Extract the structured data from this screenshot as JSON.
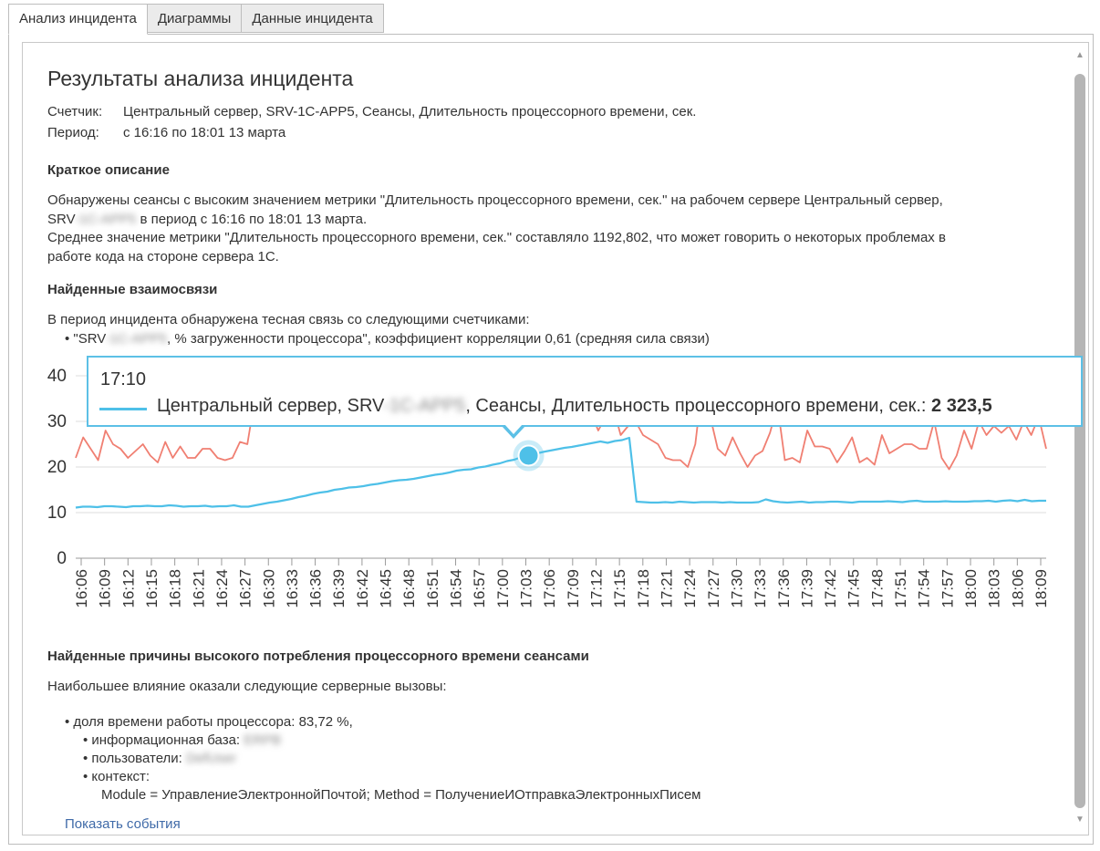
{
  "tabs": [
    {
      "label": "Анализ инцидента",
      "active": true
    },
    {
      "label": "Диаграммы",
      "active": false
    },
    {
      "label": "Данные инцидента",
      "active": false
    }
  ],
  "report": {
    "title": "Результаты анализа инцидента",
    "counter_label": "Счетчик:",
    "counter_value": "Центральный сервер, SRV-1C-APP5, Сеансы, Длительность процессорного времени, сек.",
    "period_label": "Период:",
    "period_value": "с 16:16 по 18:01 13 марта"
  },
  "summary": {
    "heading": "Краткое описание",
    "line1": "Обнаружены сеансы с высоким значением метрики \"Длительность процессорного времени, сек.\" на рабочем сервере Центральный сервер,",
    "line2_prefix": "SRV",
    "line2_blur": "-1C-APP5",
    "line2_suffix": " в период с 16:16 по 18:01 13 марта.",
    "line3": "Среднее значение метрики \"Длительность процессорного времени, сек.\" составляло 1192,802, что может говорить о некоторых проблемах в",
    "line4": "работе кода на стороне сервера 1С."
  },
  "relations": {
    "heading": "Найденные взаимосвязи",
    "intro": "В период инцидента обнаружена тесная связь со следующими счетчиками:",
    "item_prefix": "• \"SRV",
    "item_blur": "-1C-APP5",
    "item_suffix": ", % загруженности процессора\", коэффициент корреляции 0,61 (средняя сила связи)"
  },
  "tooltip": {
    "time": "17:10",
    "series_prefix": "Центральный сервер, SRV",
    "series_blur": "-1C-APP5",
    "series_suffix": ", Сеансы, Длительность процессорного времени, сек.: ",
    "value": "2 323,5"
  },
  "causes": {
    "heading": "Найденные причины высокого потребления процессорного времени сеансами",
    "intro": "Наибольшее влияние оказали следующие серверные вызовы:",
    "cpu_share": "• доля времени работы процессора: 83,72 %,",
    "infobase_label": "• информационная база:",
    "infobase_blur": "ERPB",
    "users_label": "• пользователи:",
    "users_blur": "DefUser",
    "context_label": "• контекст:",
    "context_value": "Module = УправлениеЭлектроннойПочтой; Method = ПолучениеИОтправкаЭлектронныхПисем"
  },
  "show_events_link": "Показать события",
  "colors": {
    "cpu_series": "#f07f72",
    "session_series": "#4ec0e8",
    "accent": "#5cc0e6",
    "link": "#3f6aa8"
  },
  "chart_data": {
    "type": "line",
    "ylim": [
      0,
      40
    ],
    "yticks": [
      "0",
      "10",
      "20",
      "30",
      "40"
    ],
    "x_labels": [
      "16:06",
      "16:09",
      "16:12",
      "16:15",
      "16:18",
      "16:21",
      "16:24",
      "16:27",
      "16:30",
      "16:33",
      "16:36",
      "16:39",
      "16:42",
      "16:45",
      "16:48",
      "16:51",
      "16:54",
      "16:57",
      "17:00",
      "17:03",
      "17:06",
      "17:09",
      "17:12",
      "17:15",
      "17:18",
      "17:21",
      "17:24",
      "17:27",
      "17:30",
      "17:33",
      "17:36",
      "17:39",
      "17:42",
      "17:45",
      "17:48",
      "17:51",
      "17:54",
      "17:57",
      "18:00",
      "18:03",
      "18:06",
      "18:09"
    ],
    "highlight_index": 63,
    "series": [
      {
        "key": "cpu",
        "color": "#f07f72",
        "values": [
          22,
          26.5,
          24,
          21.5,
          28,
          25,
          24,
          22,
          23.5,
          25,
          22.5,
          21,
          25.5,
          22,
          24.5,
          22,
          22,
          24,
          24,
          22,
          21.5,
          22,
          25.5,
          25,
          35,
          32,
          33,
          34,
          35,
          32,
          34,
          33,
          35,
          34,
          31,
          35,
          33,
          36,
          34,
          32,
          33,
          35,
          32,
          35,
          37,
          33,
          34,
          31,
          35,
          33,
          36,
          33,
          32,
          34,
          36,
          33,
          35,
          33,
          34,
          36,
          34,
          32,
          35,
          34,
          37,
          33,
          34,
          36,
          35,
          32,
          28,
          31,
          33,
          27,
          29,
          30,
          27,
          26,
          25,
          22,
          21.5,
          21.5,
          20,
          25,
          39,
          31,
          24,
          22.5,
          26.5,
          23,
          20,
          22.5,
          23.5,
          27.5,
          33.5,
          21.5,
          22,
          21,
          28,
          24.5,
          24.5,
          24,
          21,
          23.5,
          26.5,
          21,
          22,
          20.5,
          27,
          23,
          24,
          25,
          25,
          24,
          24,
          30,
          22,
          19.5,
          22.5,
          28,
          24,
          30,
          27,
          29,
          27.5,
          29,
          26,
          30,
          27,
          31,
          24
        ]
      },
      {
        "key": "sessions",
        "color": "#4ec0e8",
        "values": [
          11.1,
          11.3,
          11.3,
          11.2,
          11.4,
          11.4,
          11.3,
          11.2,
          11.4,
          11.4,
          11.5,
          11.4,
          11.4,
          11.6,
          11.5,
          11.3,
          11.4,
          11.4,
          11.5,
          11.3,
          11.4,
          11.4,
          11.6,
          11.3,
          11.3,
          11.6,
          11.9,
          12.2,
          12.4,
          12.7,
          13.0,
          13.4,
          13.7,
          14.1,
          14.4,
          14.6,
          15.0,
          15.2,
          15.5,
          15.6,
          15.8,
          16.1,
          16.3,
          16.6,
          16.9,
          17.1,
          17.2,
          17.4,
          17.7,
          18.0,
          18.3,
          18.5,
          18.8,
          19.2,
          19.4,
          19.5,
          19.9,
          20.1,
          20.5,
          20.8,
          21.3,
          21.6,
          22.2,
          22.5,
          22.9,
          23.3,
          23.6,
          23.9,
          24.2,
          24.4,
          24.7,
          25.0,
          25.3,
          25.6,
          25.3,
          25.7,
          25.9,
          26.4,
          12.4,
          12.3,
          12.2,
          12.2,
          12.3,
          12.2,
          12.4,
          12.3,
          12.2,
          12.3,
          12.3,
          12.3,
          12.2,
          12.3,
          12.2,
          12.2,
          12.2,
          12.3,
          12.9,
          12.5,
          12.3,
          12.2,
          12.3,
          12.4,
          12.2,
          12.3,
          12.3,
          12.4,
          12.4,
          12.3,
          12.2,
          12.4,
          12.4,
          12.4,
          12.4,
          12.5,
          12.4,
          12.3,
          12.5,
          12.6,
          12.4,
          12.4,
          12.4,
          12.5,
          12.4,
          12.4,
          12.4,
          12.5,
          12.5,
          12.6,
          12.4,
          12.6,
          12.7,
          12.5,
          12.8,
          12.5,
          12.6,
          12.6
        ]
      }
    ]
  }
}
